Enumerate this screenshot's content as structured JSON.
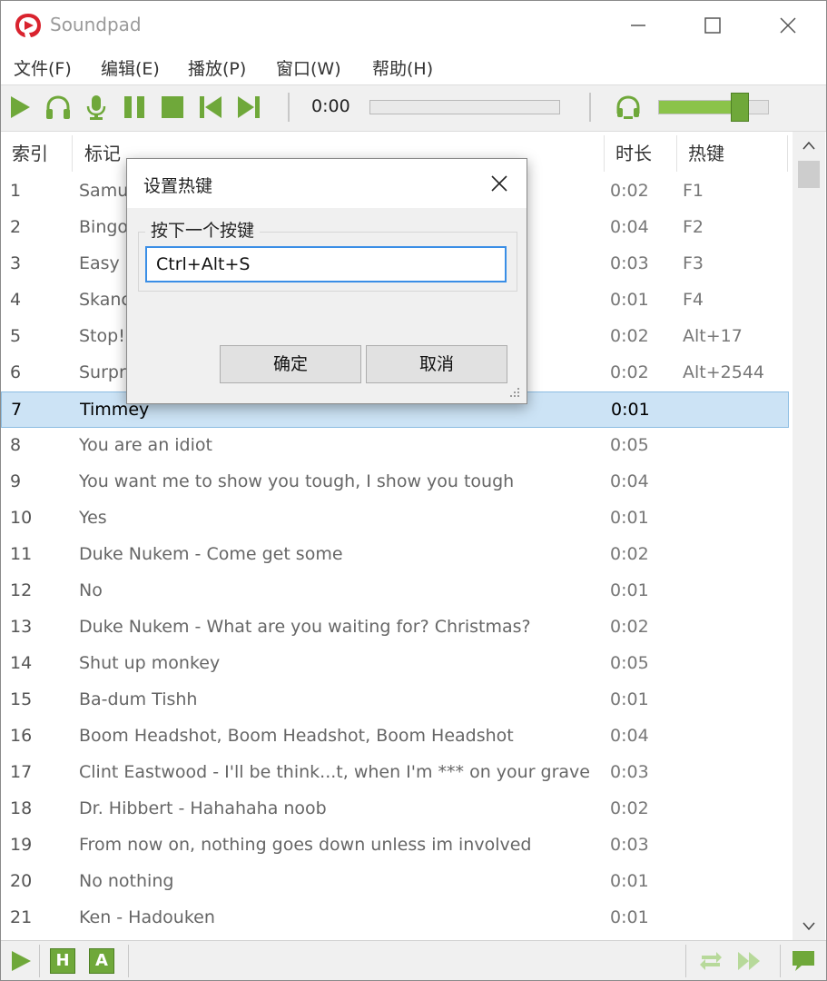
{
  "app": {
    "title": "Soundpad"
  },
  "menu": [
    "文件(F)",
    "编辑(E)",
    "播放(P)",
    "窗口(W)",
    "帮助(H)"
  ],
  "player": {
    "time": "0:00",
    "volume_fraction": 0.73
  },
  "columns": {
    "index": "索引",
    "title": "标记",
    "duration": "时长",
    "hotkey": "热键"
  },
  "rows": [
    {
      "index": "1",
      "title": "Samu",
      "duration": "0:02",
      "hotkey": "F1"
    },
    {
      "index": "2",
      "title": "Bingo",
      "duration": "0:04",
      "hotkey": "F2"
    },
    {
      "index": "3",
      "title": "Easy p",
      "duration": "0:03",
      "hotkey": "F3"
    },
    {
      "index": "4",
      "title": "Skanc",
      "duration": "0:01",
      "hotkey": "F4"
    },
    {
      "index": "5",
      "title": "Stop!",
      "duration": "0:02",
      "hotkey": "Alt+17"
    },
    {
      "index": "6",
      "title": "Surpri",
      "duration": "0:02",
      "hotkey": "Alt+2544"
    },
    {
      "index": "7",
      "title": "Timmey",
      "duration": "0:01",
      "hotkey": "",
      "selected": true
    },
    {
      "index": "8",
      "title": "You are an idiot",
      "duration": "0:05",
      "hotkey": ""
    },
    {
      "index": "9",
      "title": "You want me to show you tough, I show you tough",
      "duration": "0:04",
      "hotkey": ""
    },
    {
      "index": "10",
      "title": "Yes",
      "duration": "0:01",
      "hotkey": ""
    },
    {
      "index": "11",
      "title": "Duke Nukem - Come get some",
      "duration": "0:02",
      "hotkey": ""
    },
    {
      "index": "12",
      "title": "No",
      "duration": "0:01",
      "hotkey": ""
    },
    {
      "index": "13",
      "title": "Duke Nukem - What are you waiting for? Christmas?",
      "duration": "0:02",
      "hotkey": ""
    },
    {
      "index": "14",
      "title": "Shut up monkey",
      "duration": "0:05",
      "hotkey": ""
    },
    {
      "index": "15",
      "title": "Ba-dum Tishh",
      "duration": "0:01",
      "hotkey": ""
    },
    {
      "index": "16",
      "title": "Boom Headshot, Boom Headshot, Boom Headshot",
      "duration": "0:04",
      "hotkey": ""
    },
    {
      "index": "17",
      "title": "Clint Eastwood - I'll be think...t, when I'm *** on your grave",
      "duration": "0:03",
      "hotkey": ""
    },
    {
      "index": "18",
      "title": "Dr. Hibbert - Hahahaha noob",
      "duration": "0:02",
      "hotkey": ""
    },
    {
      "index": "19",
      "title": "From now on, nothing goes down unless im involved",
      "duration": "0:03",
      "hotkey": ""
    },
    {
      "index": "20",
      "title": "No nothing",
      "duration": "0:01",
      "hotkey": ""
    },
    {
      "index": "21",
      "title": "Ken - Hadouken",
      "duration": "0:01",
      "hotkey": ""
    }
  ],
  "dialog": {
    "title": "设置热键",
    "group_label": "按下一个按键",
    "input_value": "Ctrl+Alt+S",
    "ok_label": "确定",
    "cancel_label": "取消"
  },
  "statusbar": {
    "h_label": "H",
    "a_label": "A"
  },
  "colors": {
    "accent_green": "#6fa83a",
    "selection": "#cce3f5",
    "logo_red": "#d9232e"
  },
  "icons": [
    "soundpad-logo-icon",
    "play-icon",
    "headphones-icon",
    "microphone-icon",
    "pause-icon",
    "stop-icon",
    "previous-icon",
    "next-icon",
    "headset-icon",
    "repeat-icon",
    "forward-icon",
    "speech-bubble-icon"
  ]
}
